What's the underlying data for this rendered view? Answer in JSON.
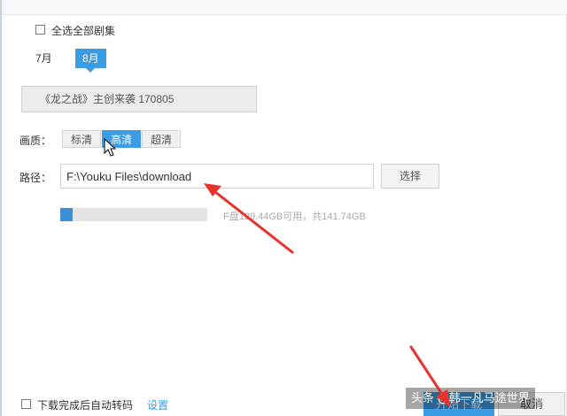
{
  "select_all": {
    "label": "全选全部剧集",
    "checked": false
  },
  "months": [
    {
      "label": "7月",
      "active": false
    },
    {
      "label": "8月",
      "active": true
    }
  ],
  "episode": {
    "title": "《龙之战》主创来袭 170805"
  },
  "quality": {
    "label": "画质：",
    "options": [
      {
        "label": "标清",
        "active": false
      },
      {
        "label": "高清",
        "active": true
      },
      {
        "label": "超清",
        "active": false
      }
    ]
  },
  "path": {
    "label": "路径：",
    "value": "F:\\Youku Files\\download",
    "choose_label": "选择"
  },
  "disk": {
    "info": "F盘129.44GB可用，共141.74GB",
    "used_fraction": 0.087
  },
  "footer": {
    "auto_transcode_label": "下载完成后自动转码",
    "auto_transcode_checked": false,
    "settings_label": "设置",
    "start_label": "开始下载",
    "cancel_label": "取消"
  },
  "watermark": "头条 @韩一凡马途世界",
  "colors": {
    "accent": "#3b9be3",
    "annotation_arrow": "#e8322c"
  }
}
